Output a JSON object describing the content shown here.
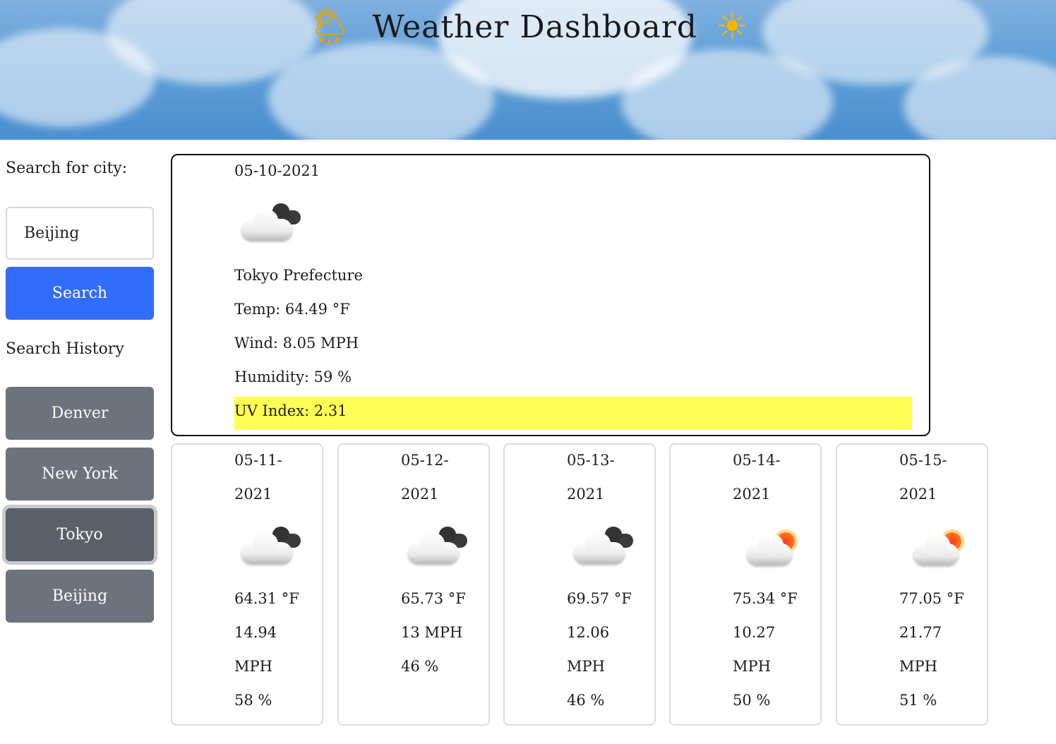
{
  "header": {
    "title": "Weather Dashboard",
    "left_icon": "sun-behind-rain-cloud-icon",
    "right_icon": "sun-icon"
  },
  "sidebar": {
    "search_label": "Search for city:",
    "search_value": "Beijing",
    "search_button": "Search",
    "history_label": "Search History",
    "history": [
      "Denver",
      "New York",
      "Tokyo",
      "Beijing"
    ],
    "active_history": "Tokyo"
  },
  "current": {
    "date": "05-10-2021",
    "icon": "cloudy-icon",
    "city": "Tokyo Prefecture",
    "temp": "Temp: 64.49 °F",
    "wind": "Wind: 8.05 MPH",
    "humidity": "Humidity: 59 %",
    "uv": "UV Index: 2.31",
    "uv_color": "#ffff55"
  },
  "forecast": [
    {
      "date_line1": "05-11-",
      "date_line2": "2021",
      "icon": "cloudy-icon",
      "temp": "64.31 °F",
      "wind_line1": "14.94",
      "wind_line2": "MPH",
      "humidity": "58 %"
    },
    {
      "date_line1": "05-12-",
      "date_line2": "2021",
      "icon": "cloudy-icon",
      "temp": "65.73 °F",
      "wind_line1": "13 MPH",
      "wind_line2": "",
      "humidity": "46 %"
    },
    {
      "date_line1": "05-13-",
      "date_line2": "2021",
      "icon": "cloudy-icon",
      "temp": "69.57 °F",
      "wind_line1": "12.06",
      "wind_line2": "MPH",
      "humidity": "46 %"
    },
    {
      "date_line1": "05-14-",
      "date_line2": "2021",
      "icon": "partly-sunny-icon",
      "temp": "75.34 °F",
      "wind_line1": "10.27",
      "wind_line2": "MPH",
      "humidity": "50 %"
    },
    {
      "date_line1": "05-15-",
      "date_line2": "2021",
      "icon": "partly-sunny-icon",
      "temp": "77.05 °F",
      "wind_line1": "21.77",
      "wind_line2": "MPH",
      "humidity": "51 %"
    }
  ],
  "colors": {
    "primary_button": "#316dfa",
    "history_button": "#6c737c",
    "uv_highlight": "#ffff55"
  }
}
